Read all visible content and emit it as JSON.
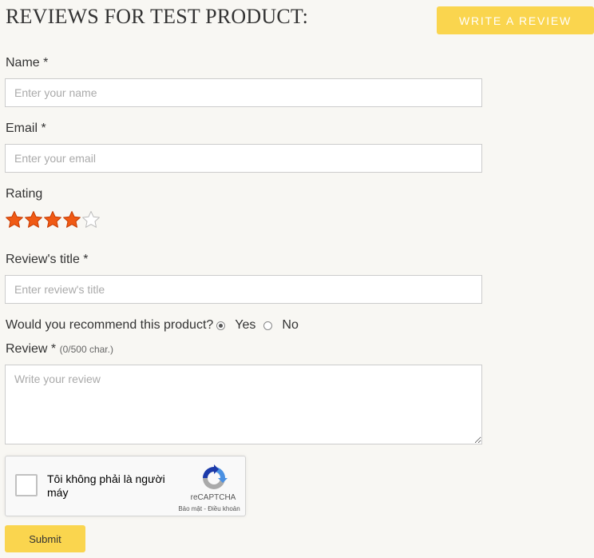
{
  "header": {
    "title": "REVIEWS FOR TEST PRODUCT:",
    "write_button": "WRITE A REVIEW"
  },
  "form": {
    "name": {
      "label": "Name *",
      "placeholder": "Enter your name",
      "value": ""
    },
    "email": {
      "label": "Email *",
      "placeholder": "Enter your email",
      "value": ""
    },
    "rating": {
      "label": "Rating",
      "value": 4,
      "max": 5,
      "filled_color": "#f05a14",
      "empty_color": "#ffffff"
    },
    "review_title": {
      "label": "Review's title *",
      "placeholder": "Enter review's title",
      "value": ""
    },
    "recommend": {
      "question": "Would you recommend this product?",
      "options": [
        "Yes",
        "No"
      ],
      "selected": "Yes"
    },
    "review": {
      "label": "Review *",
      "char_count": "(0/500 char.)",
      "placeholder": "Write your review",
      "value": ""
    },
    "captcha": {
      "text": "Tôi không phải là người máy",
      "brand": "reCAPTCHA",
      "links": "Bảo mật - Điều khoản"
    },
    "submit_label": "Submit"
  },
  "colors": {
    "accent": "#fad54e",
    "background": "#f8f7f3"
  }
}
